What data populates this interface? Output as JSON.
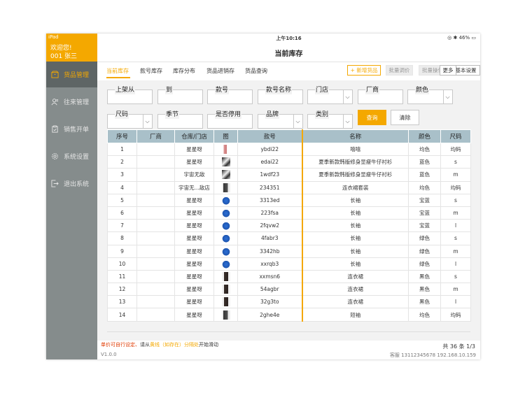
{
  "statusbar": {
    "device": "iPad",
    "time": "上午10:16",
    "battery": "46%"
  },
  "sidebar": {
    "welcome": "欢迎您!",
    "user": "001  张三",
    "items": [
      {
        "label": "货品管理",
        "icon": "box-icon",
        "active": true
      },
      {
        "label": "往来管理",
        "icon": "contacts-icon",
        "active": false
      },
      {
        "label": "销售开单",
        "icon": "clipboard-icon",
        "active": false
      },
      {
        "label": "系统设置",
        "icon": "gear-icon",
        "active": false
      },
      {
        "label": "退出系统",
        "icon": "exit-icon",
        "active": false
      }
    ]
  },
  "page_title": "当前库存",
  "tabs": [
    "当前库存",
    "款号库存",
    "库存分布",
    "货品进销存",
    "货品查询"
  ],
  "buttons": {
    "add": "+ 新增货品",
    "batch_price": "批量调价",
    "batch_op": "批量操作",
    "settings": "基本设置",
    "more": "更多"
  },
  "filters": {
    "shelf_from": "上架从",
    "to": "到",
    "style_no": "款号",
    "style_name": "款号名称",
    "store": "门店",
    "vendor": "厂商",
    "color": "颜色",
    "size": "尺码",
    "season": "季节",
    "disabled": "是否停用",
    "brand": "品牌",
    "category": "类别",
    "query": "查询",
    "clear": "清除"
  },
  "table": {
    "headers": [
      "序号",
      "厂商",
      "仓库/门店",
      "图",
      "款号",
      "名称",
      "颜色",
      "尺码"
    ],
    "rows": [
      [
        "1",
        "",
        "星星呀",
        "",
        "ybdi22",
        "嘻嘻",
        "均色",
        "均码"
      ],
      [
        "2",
        "",
        "星星呀",
        "",
        "edai22",
        "夏季新款韩版修身显瘦牛仔衬衫",
        "蓝色",
        "s"
      ],
      [
        "3",
        "",
        "宇宙无敌",
        "",
        "1wdf23",
        "夏季新款韩版修身显瘦牛仔衬衫",
        "蓝色",
        "m"
      ],
      [
        "4",
        "",
        "宇宙无...敌店",
        "",
        "234351",
        "连衣裙套装",
        "均色",
        "均码"
      ],
      [
        "5",
        "",
        "星星呀",
        "",
        "3313ed",
        "长袖",
        "宝蓝",
        "s"
      ],
      [
        "6",
        "",
        "星星呀",
        "",
        "223fsa",
        "长袖",
        "宝蓝",
        "m"
      ],
      [
        "7",
        "",
        "星星呀",
        "",
        "2fqvw2",
        "长袖",
        "宝蓝",
        "l"
      ],
      [
        "8",
        "",
        "星星呀",
        "",
        "4fabr3",
        "长袖",
        "绿色",
        "s"
      ],
      [
        "9",
        "",
        "星星呀",
        "",
        "3342hb",
        "长袖",
        "绿色",
        "m"
      ],
      [
        "10",
        "",
        "星星呀",
        "",
        "xxrqb3",
        "长袖",
        "绿色",
        "l"
      ],
      [
        "11",
        "",
        "星星呀",
        "",
        "xxmsn6",
        "连衣裙",
        "黑色",
        "s"
      ],
      [
        "12",
        "",
        "星星呀",
        "",
        "54agbr",
        "连衣裙",
        "黑色",
        "m"
      ],
      [
        "13",
        "",
        "星星呀",
        "",
        "32g3to",
        "连衣裙",
        "黑色",
        "l"
      ],
      [
        "14",
        "",
        "星星呀",
        "",
        "2ghe4e",
        "短袖",
        "均色",
        "均码"
      ]
    ],
    "thumbs": [
      "pink-figure",
      "bw-figure",
      "bw-figure",
      "dark-figure",
      "blue-shirt",
      "blue-shirt",
      "blue-shirt",
      "blue-shirt",
      "blue-shirt",
      "blue-shirt",
      "dark-dress",
      "dark-dress",
      "dark-dress",
      "dark-figure"
    ]
  },
  "footer": {
    "note_a": "单价可自行设定、",
    "note_b": "请从",
    "note_c": "黄线（如存在）分隔处",
    "note_d": "开始滑动",
    "pager": "共 36 条 1/3",
    "version": "V1.0.0",
    "service": "客服 13112345678 192.168.10.159"
  },
  "colors": {
    "accent": "#f4a800",
    "sidebar": "#858c8c",
    "header_row": "#a9c0c9"
  }
}
